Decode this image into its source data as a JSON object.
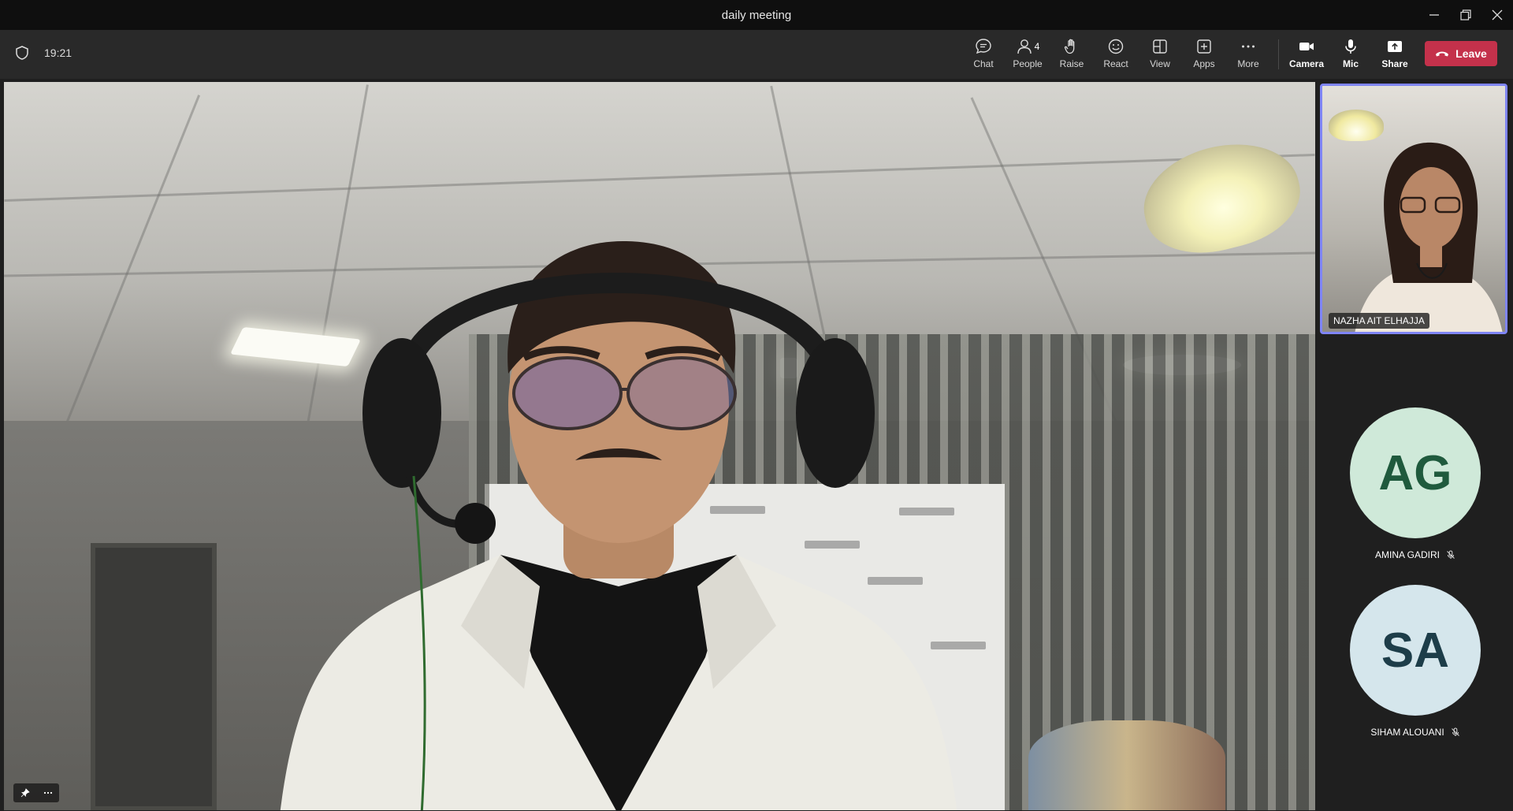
{
  "window": {
    "title": "daily meeting"
  },
  "toolbar": {
    "timer": "19:21",
    "people_count": "4",
    "items": {
      "chat": "Chat",
      "people": "People",
      "raise": "Raise",
      "react": "React",
      "view": "View",
      "apps": "Apps",
      "more": "More",
      "camera": "Camera",
      "mic": "Mic",
      "share": "Share"
    },
    "leave_label": "Leave"
  },
  "participants": {
    "featured": {
      "name": "NAZHA AIT ELHAJJA"
    },
    "others": [
      {
        "initials": "AG",
        "name": "AMINA GADIRI",
        "muted": true,
        "avatar_bg": "#cfe9d9",
        "avatar_fg": "#1f5a3d"
      },
      {
        "initials": "SA",
        "name": "SIHAM ALOUANI",
        "muted": true,
        "avatar_bg": "#d5e6ec",
        "avatar_fg": "#1d3d49"
      }
    ]
  },
  "colors": {
    "accent": "#7f85f5",
    "leave": "#c4314b",
    "toolbar_bg": "#292929",
    "titlebar_bg": "#0f0f0f"
  },
  "icons": [
    "shield-icon",
    "chat-icon",
    "people-icon",
    "raise-hand-icon",
    "react-icon",
    "view-icon",
    "apps-icon",
    "more-icon",
    "camera-icon",
    "mic-icon",
    "share-icon",
    "phone-hangup-icon",
    "pin-icon",
    "mic-off-icon",
    "minimize-icon",
    "restore-icon",
    "close-icon"
  ]
}
